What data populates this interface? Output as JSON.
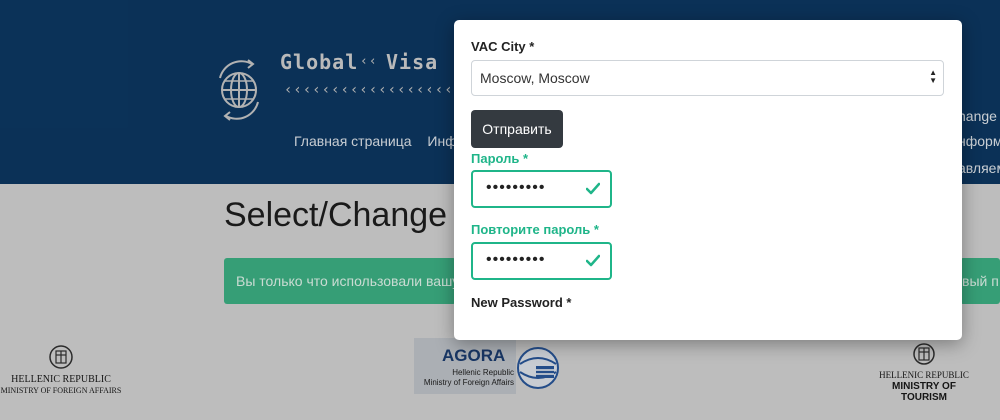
{
  "logo": {
    "word_left": "Global",
    "word_right": "Visa",
    "arrows_top": "‹‹",
    "arrows_bottom": "‹‹‹‹‹‹‹‹‹‹‹‹‹‹‹‹‹‹‹‹‹‹"
  },
  "nav": {
    "items": [
      "Главная страница",
      "Инфор"
    ],
    "right_items": [
      "hange V",
      "нформ",
      "авляем"
    ]
  },
  "page": {
    "title": "Select/Change V",
    "alert_text": "Вы только что использовали вашу с",
    "alert_right_text": "вый п"
  },
  "modal": {
    "vac_city_label": "VAC City *",
    "vac_city_value": "Moscow, Moscow",
    "submit_label": "Отправить",
    "password_label": "Пароль *",
    "password_value": "•••••••••",
    "repeat_password_label": "Повторите пароль *",
    "repeat_password_value": "•••••••••",
    "new_password_label": "New Password *"
  },
  "footer": {
    "left_line1": "HELLENIC REPUBLIC",
    "left_line2": "MINISTRY OF FOREIGN AFFAIRS",
    "agora_title": "AGORA",
    "agora_line1": "Hellenic Republic",
    "agora_line2": "Ministry of Foreign Affairs",
    "right_line1": "HELLENIC REPUBLIC",
    "right_line2": "MINISTRY OF TOURISM"
  },
  "colors": {
    "header_bg": "#0d3a66",
    "valid_green": "#1fb589",
    "button_dark": "#343a40",
    "alert_green": "#3fb98a"
  },
  "icons": [
    "globe-logo-icon",
    "select-arrows-icon",
    "check-icon",
    "hellenic-emblem-icon",
    "agora-globe-icon"
  ]
}
